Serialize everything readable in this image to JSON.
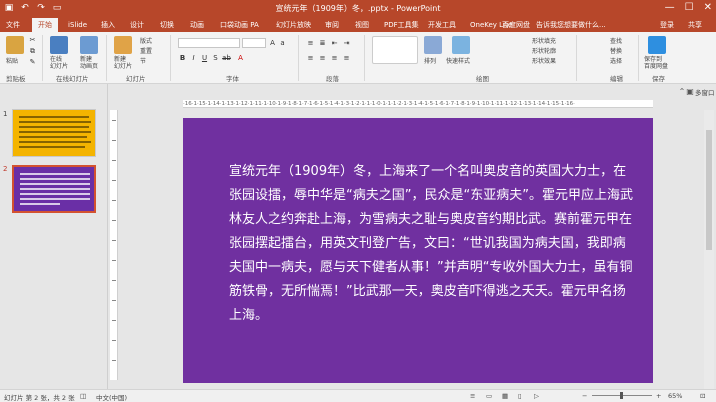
{
  "window": {
    "title": "宣统元年（1909年）冬，.pptx - PowerPoint",
    "controls": [
      "—",
      "☐",
      "✕"
    ]
  },
  "tabs": [
    {
      "label": "文件",
      "active": false
    },
    {
      "label": "开始",
      "active": true
    },
    {
      "label": "iSlide",
      "active": false
    },
    {
      "label": "插入",
      "active": false
    },
    {
      "label": "设计",
      "active": false
    },
    {
      "label": "切换",
      "active": false
    },
    {
      "label": "动画",
      "active": false
    },
    {
      "label": "口袋动画 PA",
      "active": false
    },
    {
      "label": "幻灯片放映",
      "active": false
    },
    {
      "label": "审阅",
      "active": false
    },
    {
      "label": "视图",
      "active": false
    },
    {
      "label": "PDF工具集",
      "active": false
    },
    {
      "label": "开发工具",
      "active": false
    },
    {
      "label": "OneKey Lite",
      "active": false
    },
    {
      "label": "百度网盘",
      "active": false
    }
  ],
  "tellme": "告诉我您想要做什么...",
  "login": "登录",
  "share": "共享",
  "ribbon": {
    "paste": "粘贴",
    "new_slide_in_place": "在线\n幻灯片",
    "new_layout": "新建\n动画页",
    "new_slide": "新建\n幻灯片",
    "layout": "版式",
    "reset": "重置",
    "section": "节",
    "font_group": "字体",
    "paragraph_group": "段落",
    "draw_group": "绘图",
    "arrange": "排列",
    "quick_styles": "快速样式",
    "shape_fill": "形状填充",
    "shape_outline": "形状轮廓",
    "shape_effects": "形状效果",
    "find": "查找",
    "replace": "替换",
    "select": "选择",
    "edit_group": "编辑",
    "save_to_baidu": "保存到\n百度网盘",
    "save_group": "保存",
    "clipboard_group": "剪贴板",
    "online_slides_group": "在线幻灯片",
    "slides_group": "幻灯片"
  },
  "pane": {
    "thumb1_number": "1",
    "thumb2_number": "2"
  },
  "right_pane": {
    "label": "多窗口"
  },
  "ruler_text": "·16·1·15·1·14·1·13·1·12·1·11·1·10·1·9·1·8·1·7·1·6·1·5·1·4·1·3·1·2·1·1·1·0·1·1·1·2·1·3·1·4·1·5·1·6·1·7·1·8·1·9·1·10·1·11·1·12·1·13·1·14·1·15·1·16·",
  "slide": {
    "text": "宣统元年（1909年）冬，上海来了一个名叫奥皮音的英国大力士，在张园设擂，辱中华是“病夫之国”，民众是“东亚病夫”。霍元甲应上海武林友人之约奔赴上海，为雪病夫之耻与奥皮音约期比武。赛前霍元甲在张园摆起擂台，用英文刊登广告，文曰：“世讥我国为病夫国，我即病夫国中一病夫，愿与天下健者从事！”并声明“专收外国大力士，虽有铜筋铁骨，无所惴焉！”比武那一天，奥皮音吓得逃之夭夭。霍元甲名扬上海。"
  },
  "status": {
    "slide_info": "幻灯片 第 2 张，共 2 张",
    "language": "中文(中国)",
    "zoom": "65%"
  },
  "colors": {
    "accent": "#b7472a",
    "slide_bg": "#7030a0",
    "thumb1_bg": "#f4b400"
  }
}
